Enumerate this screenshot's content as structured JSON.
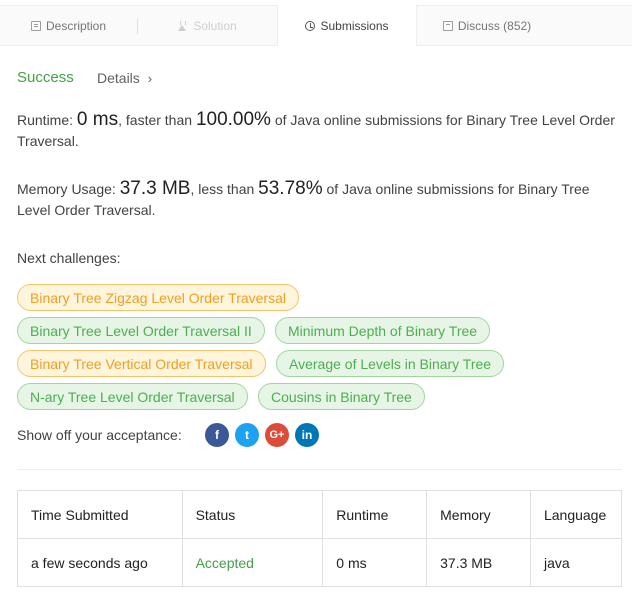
{
  "tabs": [
    {
      "label": "Description",
      "icon": "description-icon",
      "state": "normal"
    },
    {
      "label": "Solution",
      "icon": "flask-icon",
      "state": "disabled"
    },
    {
      "label": "Submissions",
      "icon": "clock-icon",
      "state": "active"
    },
    {
      "label": "Discuss (852)",
      "icon": "chat-icon",
      "state": "normal"
    }
  ],
  "result": {
    "status": "Success",
    "details_label": "Details",
    "details_chevron": "›"
  },
  "runtime": {
    "prefix": "Runtime: ",
    "value": "0 ms",
    "mid": ", faster than ",
    "percent": "100.00%",
    "suffix": " of Java online submissions for Binary Tree Level Order Traversal."
  },
  "memory": {
    "prefix": "Memory Usage: ",
    "value": "37.3 MB",
    "mid": ", less than ",
    "percent": "53.78%",
    "suffix": " of Java online submissions for Binary Tree Level Order Traversal."
  },
  "next_challenges": {
    "label": "Next challenges:",
    "items": [
      {
        "label": "Binary Tree Zigzag Level Order Traversal",
        "difficulty": "medium"
      },
      {
        "label": "Binary Tree Level Order Traversal II",
        "difficulty": "easy"
      },
      {
        "label": "Minimum Depth of Binary Tree",
        "difficulty": "easy"
      },
      {
        "label": "Binary Tree Vertical Order Traversal",
        "difficulty": "medium"
      },
      {
        "label": "Average of Levels in Binary Tree",
        "difficulty": "easy"
      },
      {
        "label": "N-ary Tree Level Order Traversal",
        "difficulty": "easy"
      },
      {
        "label": "Cousins in Binary Tree",
        "difficulty": "easy"
      }
    ]
  },
  "share": {
    "label": "Show off your acceptance:",
    "buttons": [
      {
        "name": "facebook-icon",
        "glyph": "f"
      },
      {
        "name": "twitter-icon",
        "glyph": "t"
      },
      {
        "name": "google-plus-icon",
        "glyph": "G+"
      },
      {
        "name": "linkedin-icon",
        "glyph": "in"
      }
    ]
  },
  "submissions_table": {
    "columns": [
      "Time Submitted",
      "Status",
      "Runtime",
      "Memory",
      "Language"
    ],
    "rows": [
      [
        "a few seconds ago",
        "Accepted",
        "0 ms",
        "37.3 MB",
        "java"
      ]
    ]
  },
  "colors": {
    "success_green": "#43a047",
    "medium_orange": "#f0a020",
    "easy_green": "#4caf50"
  }
}
